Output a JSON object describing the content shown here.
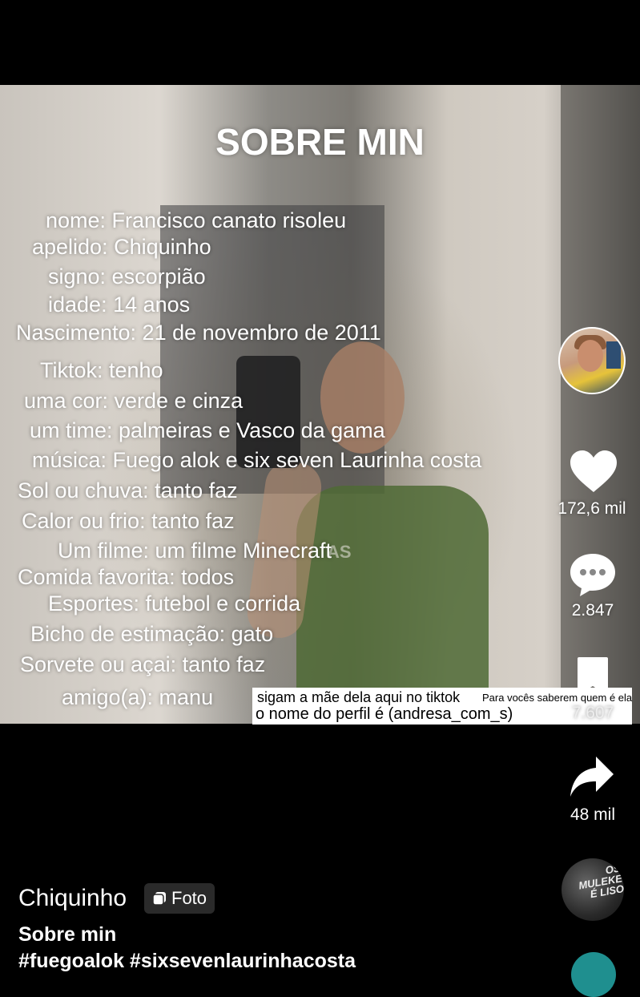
{
  "post": {
    "title": "SOBRE MIN",
    "lines": [
      "nome: Francisco canato risoleu",
      "apelido: Chiquinho",
      "signo: escorpião",
      "idade: 14 anos",
      "Nascimento: 21 de novembro de 2011",
      "Tiktok: tenho",
      "uma cor: verde e cinza",
      "um time: palmeiras e Vasco da gama",
      "música: Fuego alok e six seven Laurinha costa",
      "Sol ou chuva: tanto faz",
      "Calor ou frio: tanto faz",
      "Um filme: um filme Minecraft",
      "Comida favorita: todos",
      "Esportes: futebol e corrida",
      "Bicho de estimação: gato",
      "Sorvete ou açai: tanto faz",
      "amigo(a): manu"
    ],
    "photo_text": "AS",
    "sticker": {
      "line1": "sigam a mãe dela aqui no tiktok",
      "line1_small": "Para vocês saberem quem é ela",
      "line2": "o nome do perfil é (andresa_com_s)"
    }
  },
  "rail": {
    "likes": "172,6 mil",
    "comments": "2.847",
    "saves": "7.607",
    "shares": "48 mil"
  },
  "music": {
    "disc_text": "OS MULEKE É LISO"
  },
  "footer": {
    "author": "Chiquinho",
    "badge_label": "Foto",
    "caption": "Sobre min",
    "hashtags": "#fuegoalok #sixsevenlaurinhacosta"
  },
  "colors": {
    "background": "#000000",
    "sticker_bg": "#ffffff",
    "text": "#ffffff"
  }
}
